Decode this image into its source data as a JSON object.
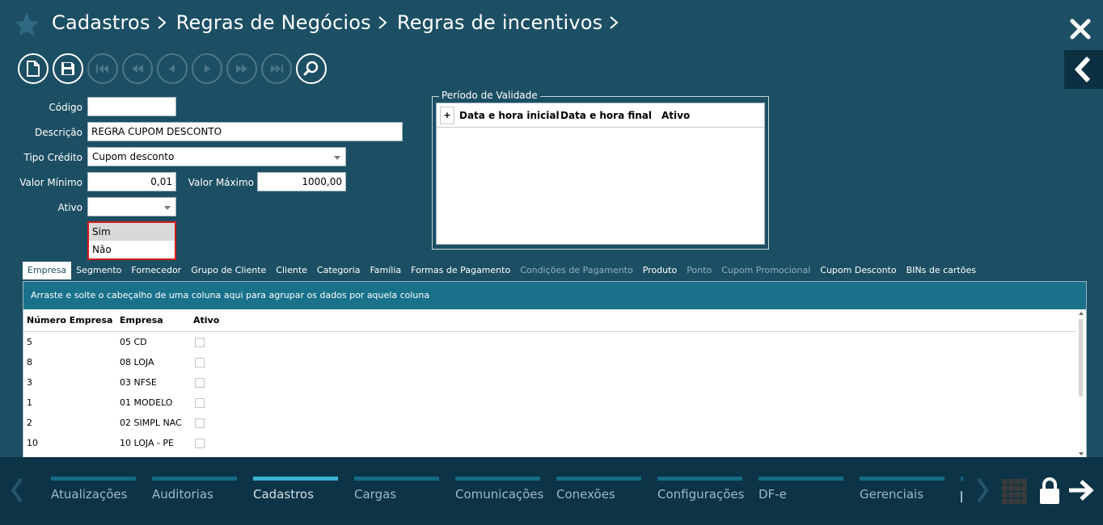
{
  "header": {
    "breadcrumbs": [
      "Cadastros",
      "Regras de Negócios",
      "Regras de incentivos"
    ]
  },
  "toolbar": {
    "buttons": [
      "new-document-icon",
      "save-icon",
      "first-record-icon",
      "rewind-icon",
      "previous-icon",
      "next-icon",
      "fast-forward-icon",
      "last-record-icon",
      "search-icon"
    ]
  },
  "form": {
    "codigo_label": "Código",
    "codigo_value": "",
    "descricao_label": "Descrição",
    "descricao_value": "REGRA CUPOM DESCONTO",
    "tipo_credito_label": "Tipo Crédito",
    "tipo_credito_value": "Cupom desconto",
    "valor_minimo_label": "Valor Mínimo",
    "valor_minimo_value": "0,01",
    "valor_maximo_label": "Valor Máximo",
    "valor_maximo_value": "1000,00",
    "ativo_label": "Ativo",
    "ativo_value": "",
    "ativo_options": [
      "Sim",
      "Não"
    ]
  },
  "periodo": {
    "legend": "Período de Validade",
    "add_label": "+",
    "columns": [
      "Data e hora inicial",
      "Data e hora final",
      "Ativo"
    ]
  },
  "tabs": [
    {
      "label": "Empresa",
      "state": "active"
    },
    {
      "label": "Segmento",
      "state": "normal"
    },
    {
      "label": "Fornecedor",
      "state": "normal"
    },
    {
      "label": "Grupo de Cliente",
      "state": "normal"
    },
    {
      "label": "Cliente",
      "state": "normal"
    },
    {
      "label": "Categoria",
      "state": "normal"
    },
    {
      "label": "Família",
      "state": "normal"
    },
    {
      "label": "Formas de Pagamento",
      "state": "normal"
    },
    {
      "label": "Condições de Pagamento",
      "state": "disabled"
    },
    {
      "label": "Produto",
      "state": "normal"
    },
    {
      "label": "Ponto",
      "state": "disabled"
    },
    {
      "label": "Cupom Promocional",
      "state": "disabled"
    },
    {
      "label": "Cupom Desconto",
      "state": "normal"
    },
    {
      "label": "BINs de cartões",
      "state": "normal"
    }
  ],
  "grid": {
    "group_hint": "Arraste e solte o cabeçalho de uma coluna aqui para agrupar os dados por aquela coluna",
    "columns": [
      "Número Empresa",
      "Empresa",
      "Ativo"
    ],
    "rows": [
      {
        "numero": "5",
        "empresa": "05 CD",
        "ativo": false
      },
      {
        "numero": "8",
        "empresa": "08 LOJA",
        "ativo": false
      },
      {
        "numero": "3",
        "empresa": "03 NFSE",
        "ativo": false
      },
      {
        "numero": "1",
        "empresa": "01 MODELO",
        "ativo": false
      },
      {
        "numero": "2",
        "empresa": "02 SIMPL NAC",
        "ativo": false
      },
      {
        "numero": "10",
        "empresa": "10 LOJA - PE",
        "ativo": false
      }
    ]
  },
  "bottom_menu": {
    "items": [
      {
        "label": "Atualizações",
        "active": false
      },
      {
        "label": "Auditorias",
        "active": false
      },
      {
        "label": "Cadastros",
        "active": true
      },
      {
        "label": "Cargas",
        "active": false
      },
      {
        "label": "Comunicações",
        "active": false
      },
      {
        "label": "Conexões",
        "active": false
      },
      {
        "label": "Configurações",
        "active": false
      },
      {
        "label": "DF-e",
        "active": false
      },
      {
        "label": "Gerenciais",
        "active": false
      }
    ]
  },
  "colors": {
    "background": "#1d4f64",
    "bottom_bar": "#0c3446",
    "accent": "#3ab1d1",
    "group_bar": "#19728a",
    "dropdown_border": "#d11b1b"
  }
}
